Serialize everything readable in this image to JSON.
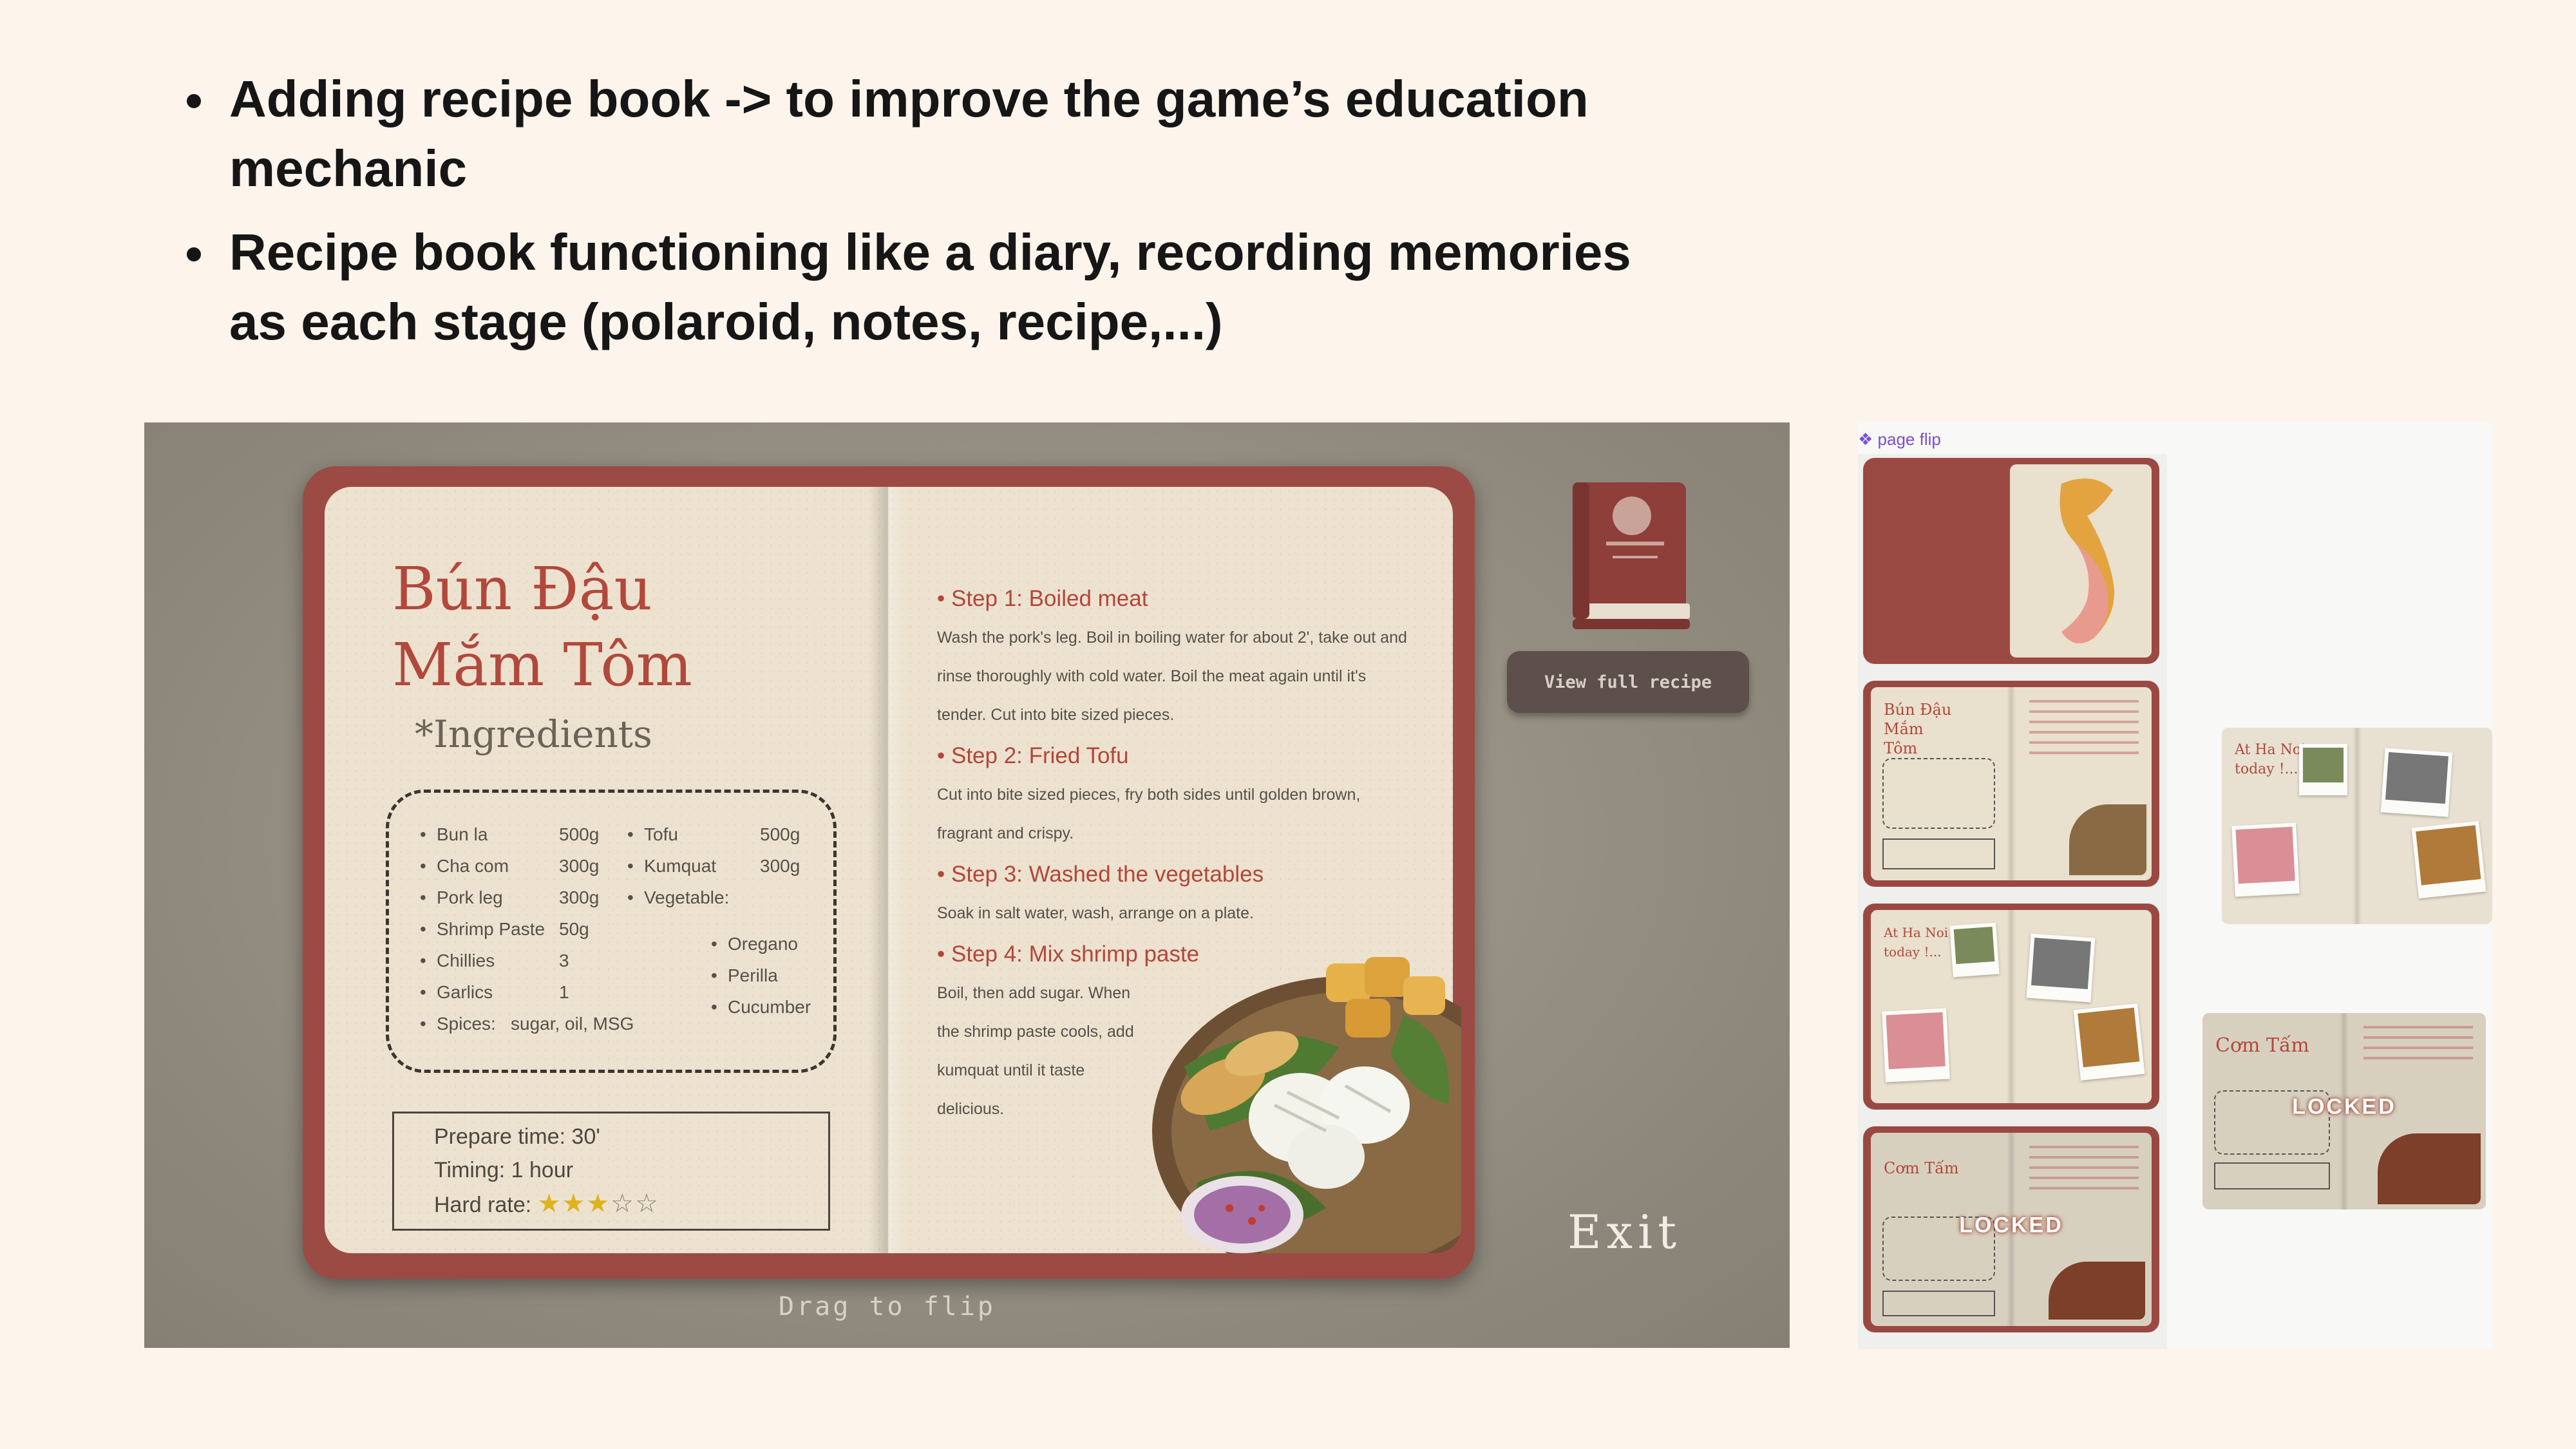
{
  "bullets": [
    {
      "text": "Adding recipe book -> to improve the game’s education mechanic"
    },
    {
      "text": "Recipe book functioning like a diary, recording memories as each stage (polaroid, notes, recipe,...)"
    }
  ],
  "game": {
    "recipe_title_line1": "Bún Đậu",
    "recipe_title_line2": "Mắm Tôm",
    "ingredients_heading": "*Ingredients",
    "ingredients_col1": [
      {
        "name": "Bun la",
        "qty": "500g"
      },
      {
        "name": "Cha com",
        "qty": "300g"
      },
      {
        "name": "Pork leg",
        "qty": "300g"
      },
      {
        "name": "Shrimp Paste",
        "qty": "50g"
      },
      {
        "name": "Chillies",
        "qty": "3"
      },
      {
        "name": "Garlics",
        "qty": "1"
      },
      {
        "name": "Spices:",
        "qty": "sugar, oil, MSG"
      }
    ],
    "ingredients_col2": [
      {
        "name": "Tofu",
        "qty": "500g"
      },
      {
        "name": "Kumquat",
        "qty": "300g"
      },
      {
        "name": "Vegetable:",
        "qty": ""
      }
    ],
    "ingredients_col3": [
      "Oregano",
      "Perilla",
      "Cucumber"
    ],
    "prepare_time": "Prepare time: 30'",
    "timing": "Timing: 1 hour",
    "hard_rate_label": "Hard rate:",
    "hard_rate_value": 3,
    "hard_rate_max": 5,
    "steps": [
      {
        "title": "Step 1: Boiled meat",
        "text": "Wash the pork's leg. Boil in boiling water for about 2', take out and rinse thoroughly with cold water. Boil the meat again until it's tender. Cut into bite sized pieces."
      },
      {
        "title": "Step 2: Fried Tofu",
        "text": "Cut into bite sized pieces, fry both sides until golden brown, fragrant and crispy."
      },
      {
        "title": "Step 3: Washed the vegetables",
        "text": "Soak in salt water, wash, arrange on a plate."
      },
      {
        "title": "Step 4: Mix shrimp paste",
        "text": "Boil, then add sugar. When the shrimp paste cools, add kumquat until it taste delicious."
      }
    ],
    "view_button": "View full recipe",
    "exit": "Exit",
    "drag_hint": "Drag to flip"
  },
  "thumbnails": {
    "label": "page flip",
    "label_icon": "component-icon",
    "pages": [
      {
        "kind": "cover",
        "title": "",
        "locked": ""
      },
      {
        "kind": "recipe",
        "title": "Bún Đậu Mắm Tôm",
        "locked": ""
      },
      {
        "kind": "diary",
        "title": "At Ha Noi today !...",
        "locked": ""
      },
      {
        "kind": "locked",
        "title": "Cơm Tấm",
        "locked": "LOCKED"
      }
    ],
    "floating": [
      {
        "title": "At Ha Noi today !..."
      },
      {
        "title": "Cơm Tấm",
        "locked": "LOCKED"
      }
    ]
  },
  "colors": {
    "background": "#fdf4ec",
    "book_cover": "#9c4b44",
    "title_red": "#b2483c",
    "star": "#e0b21e"
  }
}
